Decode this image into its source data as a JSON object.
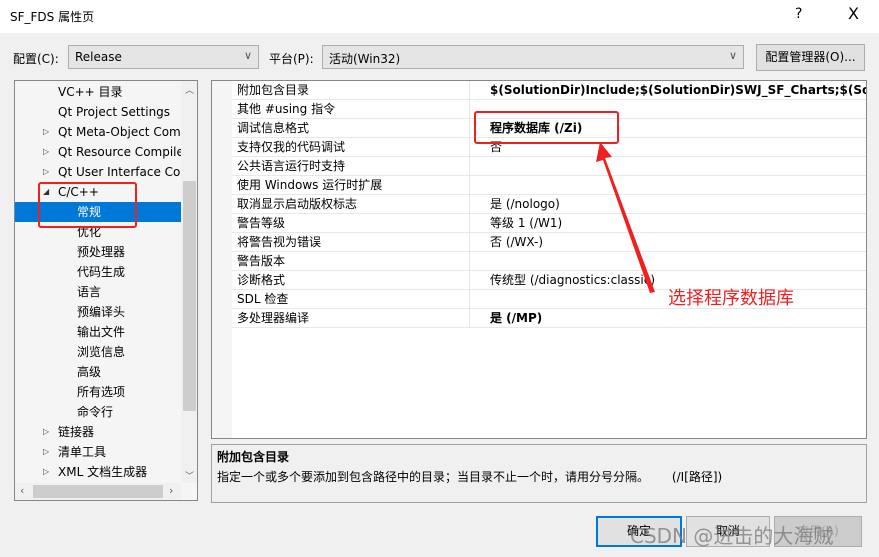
{
  "window": {
    "title": "SF_FDS 属性页",
    "help": "?",
    "close": "X"
  },
  "toolbar": {
    "config_label": "配置(C):",
    "config_value": "Release",
    "platform_label": "平台(P):",
    "platform_value": "活动(Win32)",
    "manager_button": "配置管理器(O)..."
  },
  "tree": {
    "items": [
      {
        "label": "VC++ 目录",
        "level": 1,
        "expander": ""
      },
      {
        "label": "Qt Project Settings",
        "level": 1,
        "expander": ""
      },
      {
        "label": "Qt Meta-Object Compiler",
        "level": 1,
        "expander": "collapsed"
      },
      {
        "label": "Qt Resource Compiler",
        "level": 1,
        "expander": "collapsed"
      },
      {
        "label": "Qt User Interface Compiler",
        "level": 1,
        "expander": "collapsed"
      },
      {
        "label": "C/C++",
        "level": 1,
        "expander": "expanded"
      },
      {
        "label": "常规",
        "level": 2,
        "expander": "",
        "selected": true
      },
      {
        "label": "优化",
        "level": 2,
        "expander": ""
      },
      {
        "label": "预处理器",
        "level": 2,
        "expander": ""
      },
      {
        "label": "代码生成",
        "level": 2,
        "expander": ""
      },
      {
        "label": "语言",
        "level": 2,
        "expander": ""
      },
      {
        "label": "预编译头",
        "level": 2,
        "expander": ""
      },
      {
        "label": "输出文件",
        "level": 2,
        "expander": ""
      },
      {
        "label": "浏览信息",
        "level": 2,
        "expander": ""
      },
      {
        "label": "高级",
        "level": 2,
        "expander": ""
      },
      {
        "label": "所有选项",
        "level": 2,
        "expander": ""
      },
      {
        "label": "命令行",
        "level": 2,
        "expander": ""
      },
      {
        "label": "链接器",
        "level": 1,
        "expander": "collapsed"
      },
      {
        "label": "清单工具",
        "level": 1,
        "expander": "collapsed"
      },
      {
        "label": "XML 文档生成器",
        "level": 1,
        "expander": "collapsed"
      }
    ]
  },
  "properties": [
    {
      "name": "附加包含目录",
      "value": "$(SolutionDir)Include;$(SolutionDir)SWJ_SF_Charts;$(SolutionDir)",
      "bold": true
    },
    {
      "name": "其他 #using 指令",
      "value": "",
      "bold": false
    },
    {
      "name": "调试信息格式",
      "value": "程序数据库 (/Zi)",
      "bold": true
    },
    {
      "name": "支持仅我的代码调试",
      "value": "否",
      "bold": false
    },
    {
      "name": "公共语言运行时支持",
      "value": "",
      "bold": false
    },
    {
      "name": "使用 Windows 运行时扩展",
      "value": "",
      "bold": false
    },
    {
      "name": "取消显示启动版权标志",
      "value": "是 (/nologo)",
      "bold": false
    },
    {
      "name": "警告等级",
      "value": "等级 1 (/W1)",
      "bold": false
    },
    {
      "name": "将警告视为错误",
      "value": "否 (/WX-)",
      "bold": false
    },
    {
      "name": "警告版本",
      "value": "",
      "bold": false
    },
    {
      "name": "诊断格式",
      "value": "传统型 (/diagnostics:classic)",
      "bold": false
    },
    {
      "name": "SDL 检查",
      "value": "",
      "bold": false
    },
    {
      "name": "多处理器编译",
      "value": "是 (/MP)",
      "bold": true
    }
  ],
  "description": {
    "title": "附加包含目录",
    "text": "指定一个或多个要添加到包含路径中的目录；当目录不止一个时，请用分号分隔。      (/I[路径])"
  },
  "buttons": {
    "ok": "确定",
    "cancel": "取消",
    "apply": "应用(A)"
  },
  "annotation": {
    "text": "选择程序数据库",
    "color": "#f02020"
  },
  "watermark": "CSDN @进击的大海贼",
  "colors": {
    "selection": "#0078d7",
    "annotation": "#f02020"
  }
}
